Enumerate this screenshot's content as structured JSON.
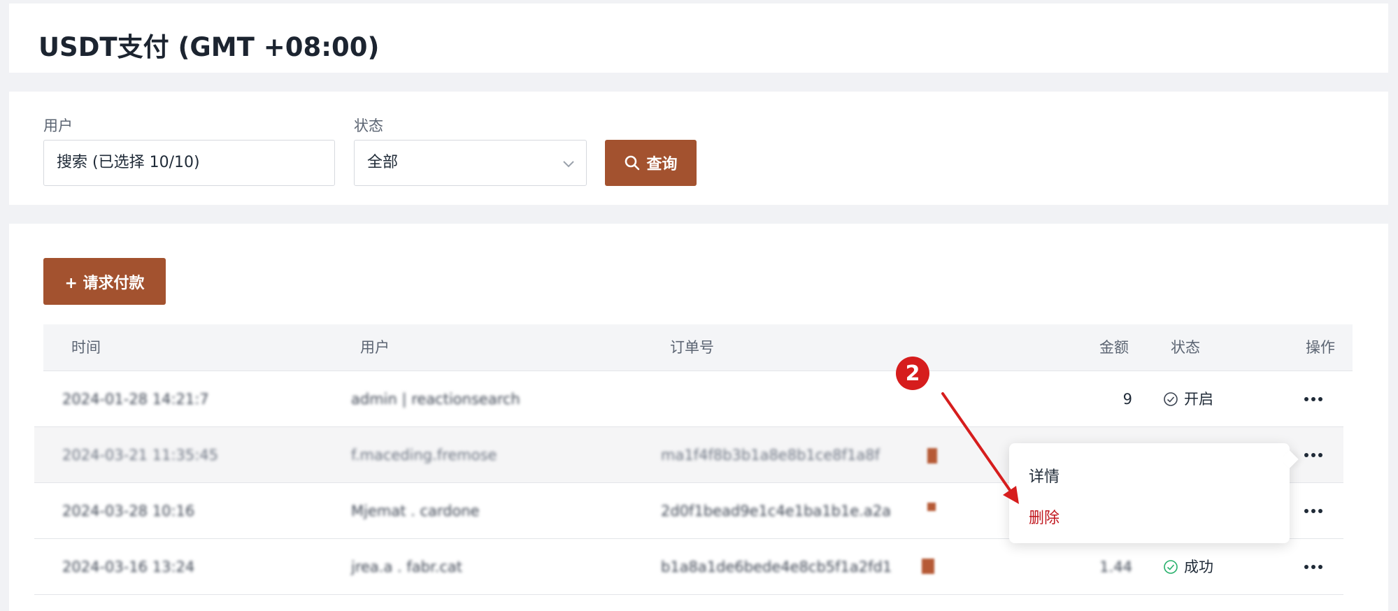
{
  "header": {
    "title": "USDT支付 (GMT +08:00)"
  },
  "filters": {
    "user_label": "用户",
    "user_value": "搜索 (已选择 10/10)",
    "status_label": "状态",
    "status_value": "全部",
    "query_button": "查询"
  },
  "toolbar": {
    "add_button": "+ 请求付款"
  },
  "table": {
    "columns": {
      "time": "时间",
      "user": "用户",
      "order": "订单号",
      "amount": "金额",
      "status": "状态",
      "action": "操作"
    },
    "rows": [
      {
        "time": "2024-01-28 14:21:7",
        "user": "admin | reactionsearch",
        "order": "",
        "amount": "9",
        "status": "开启",
        "status_icon": "check-circle-outline-icon"
      },
      {
        "time": "2024-03-21 11:35:45",
        "user": "f.maceding.fremose",
        "order": "ma1f4f8b3b1a8e8b1ce8f1a8f",
        "amount": "",
        "status": "",
        "status_icon": ""
      },
      {
        "time": "2024-03-28 10:16",
        "user": "Mjemat . cardone",
        "order": "2d0f1bead9e1c4e1ba1b1e.a2a",
        "amount": "",
        "status": "",
        "status_icon": ""
      },
      {
        "time": "2024-03-16 13:24",
        "user": "jrea.a . fabr.cat",
        "order": "b1a8a1de6bede4e8cb5f1a2fd1",
        "amount": "1.44",
        "status": "成功",
        "status_icon": "check-circle-green-icon"
      }
    ]
  },
  "context_menu": {
    "details": "详情",
    "delete": "删除"
  },
  "annotation": {
    "step_number": "2"
  },
  "colors": {
    "primary": "#a3522f",
    "danger": "#c0161d",
    "success": "#27b06b",
    "badge": "#d61d1d"
  }
}
